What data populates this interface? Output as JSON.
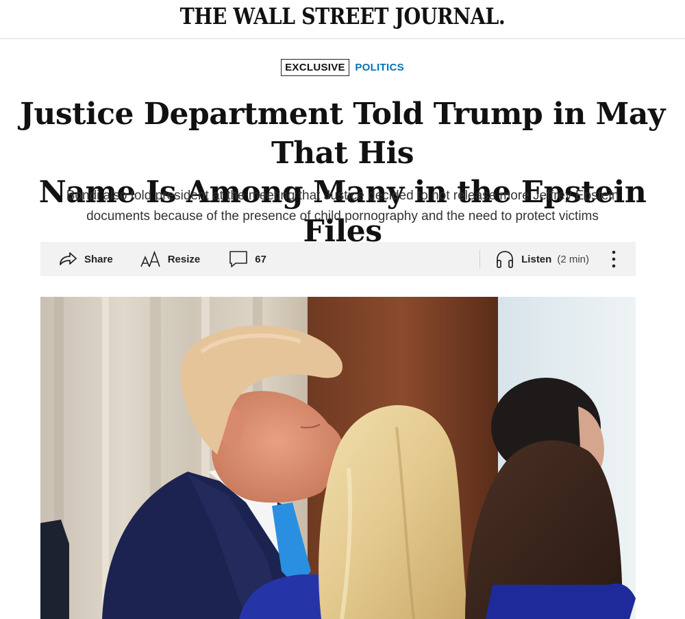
{
  "masthead": {
    "logo": "THE WALL STREET JOURNAL."
  },
  "article": {
    "badge": "EXCLUSIVE",
    "section": "POLITICS",
    "headline_line1": "Justice Department Told Trump in May That His",
    "headline_line2": "Name Is Among Many in the Epstein Files",
    "dek_line1": "Bondi also told president at the meeting that Justice decided to not release more Jeffrey Epstein",
    "dek_line2": "documents because of the presence of child pornography and the need to protect victims"
  },
  "toolbar": {
    "share_label": "Share",
    "resize_label": "Resize",
    "comments_count": "67",
    "listen_label": "Listen",
    "listen_duration": "(2 min)",
    "icons": [
      "share-icon",
      "resize-icon",
      "comment-icon",
      "headphones-icon",
      "more-vertical-icon"
    ]
  },
  "image": {
    "semantic": "news-photo"
  },
  "colors": {
    "section_accent": "#0274b6",
    "toolbar_bg": "#f2f2f2"
  }
}
